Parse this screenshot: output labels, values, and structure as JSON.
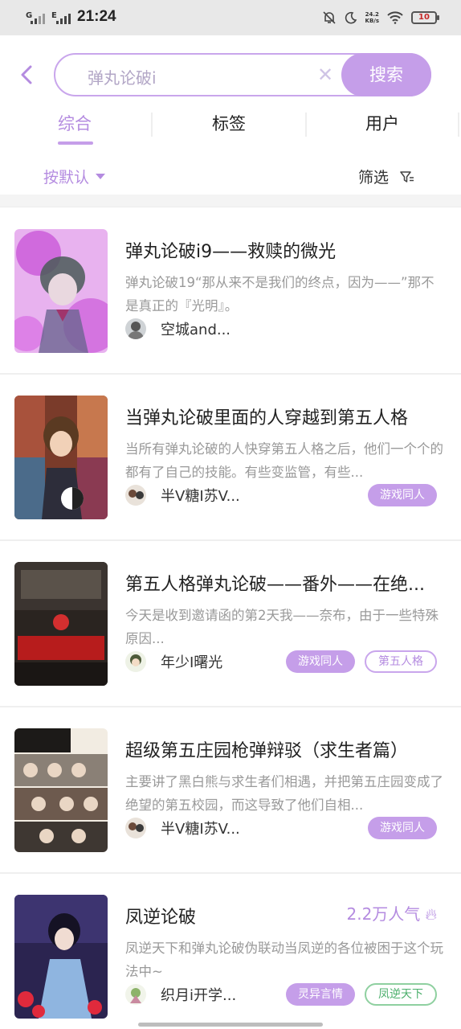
{
  "status_bar": {
    "signal1": "G",
    "signal2": "E",
    "time": "21:24",
    "speed_value": "24.2",
    "speed_unit": "KB/s",
    "battery": "10"
  },
  "search": {
    "query": "弹丸论破i",
    "button": "搜索"
  },
  "tabs": [
    {
      "label": "综合"
    },
    {
      "label": "标签"
    },
    {
      "label": "用户"
    }
  ],
  "toolbar": {
    "sort_label": "按默认",
    "filter_label": "筛选"
  },
  "colors": {
    "accent": "#c59ee9",
    "accent_text": "#b48be0",
    "green_tag": "#4caf6c"
  },
  "results": [
    {
      "title": "弹丸论破i9——救赎的微光",
      "desc": "弹丸论破19“那从来不是我们的终点，因为——”那不是真正的『光明』。",
      "author": "空城and...",
      "tags": []
    },
    {
      "title": "当弹丸论破里面的人穿越到第五人格",
      "desc": "当所有弹丸论破的人快穿第五人格之后，他们一个个的都有了自己的技能。有些变监管，有些...",
      "author": "半V糖I苏V...",
      "tags": [
        {
          "label": "游戏同人",
          "style": "filled"
        }
      ]
    },
    {
      "title": "第五人格弹丸论破——番外——在绝...",
      "desc": "今天是收到邀请函的第2天我——奈布，由于一些特殊原因...",
      "author": "年少I曙光",
      "tags": [
        {
          "label": "游戏同人",
          "style": "filled"
        },
        {
          "label": "第五人格",
          "style": "outline"
        }
      ]
    },
    {
      "title": "超级第五庄园枪弹辩驳（求生者篇）",
      "desc": "主要讲了黑白熊与求生者们相遇，并把第五庄园变成了绝望的第五校园，而这导致了他们自相...",
      "author": "半V糖I苏V...",
      "tags": [
        {
          "label": "游戏同人",
          "style": "filled"
        }
      ]
    },
    {
      "title": "凤逆论破",
      "popularity": "2.2万人气",
      "desc": "凤逆天下和弹丸论破伪联动当凤逆的各位被困于这个玩法中~",
      "author": "织月i开学...",
      "tags": [
        {
          "label": "灵异言情",
          "style": "filled"
        },
        {
          "label": "凤逆天下",
          "style": "green"
        }
      ]
    }
  ]
}
